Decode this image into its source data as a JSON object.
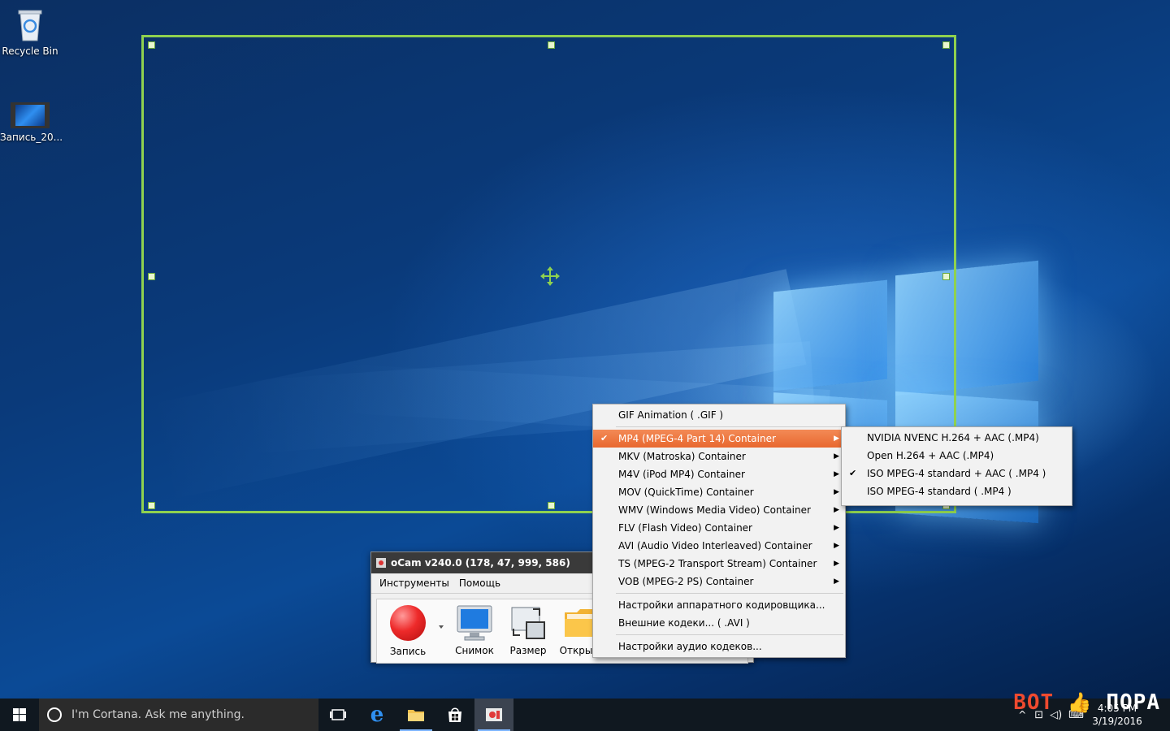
{
  "desktop": {
    "icons": [
      {
        "label": "Recycle Bin",
        "icon": "recycle-bin-icon"
      },
      {
        "label": "Запись_20...",
        "icon": "video-file-icon"
      }
    ]
  },
  "ocam": {
    "title": "oCam v240.0 (178, 47, 999, 586)",
    "menu": [
      "Инструменты",
      "Помощь"
    ],
    "tools": [
      {
        "label": "Запись",
        "icon": "record-icon"
      },
      {
        "label": "Снимок",
        "icon": "monitor-icon"
      },
      {
        "label": "Размер",
        "icon": "resize-icon"
      },
      {
        "label": "Открыть",
        "icon": "folder-icon"
      }
    ]
  },
  "format_menu": {
    "items": [
      {
        "label": "GIF Animation ( .GIF )",
        "checked": false,
        "submenu": false
      },
      {
        "label": "MP4 (MPEG-4 Part 14) Container",
        "checked": true,
        "submenu": true,
        "highlighted": true
      },
      {
        "label": "MKV (Matroska) Container",
        "checked": false,
        "submenu": true
      },
      {
        "label": "M4V (iPod MP4) Container",
        "checked": false,
        "submenu": true
      },
      {
        "label": "MOV (QuickTime) Container",
        "checked": false,
        "submenu": true
      },
      {
        "label": "WMV (Windows Media Video) Container",
        "checked": false,
        "submenu": true
      },
      {
        "label": "FLV (Flash Video) Container",
        "checked": false,
        "submenu": true
      },
      {
        "label": "AVI (Audio Video Interleaved) Container",
        "checked": false,
        "submenu": true
      },
      {
        "label": "TS (MPEG-2 Transport Stream) Container",
        "checked": false,
        "submenu": true
      },
      {
        "label": "VOB (MPEG-2 PS) Container",
        "checked": false,
        "submenu": true
      }
    ],
    "settings": [
      "Настройки аппаратного кодировщика...",
      "Внешние кодеки... ( .AVI )"
    ],
    "audio": "Настройки аудио кодеков..."
  },
  "mp4_submenu": {
    "items": [
      {
        "label": "NVIDIA NVENC H.264 + AAC (.MP4)",
        "checked": false
      },
      {
        "label": "Open H.264 + AAC (.MP4)",
        "checked": false
      },
      {
        "label": "ISO MPEG-4 standard + AAC ( .MP4 )",
        "checked": true
      },
      {
        "label": "ISO MPEG-4 standard ( .MP4 )",
        "checked": false
      }
    ]
  },
  "taskbar": {
    "search_placeholder": "I'm Cortana. Ask me anything.",
    "apps": [
      "task-view-icon",
      "edge-icon",
      "file-explorer-icon",
      "store-icon",
      "ocam-icon"
    ],
    "time": "4:05 PM",
    "date": "3/19/2016"
  },
  "watermark": {
    "part1": "BOT",
    "part2": "ПОРА"
  },
  "colors": {
    "accent": "#e8682f",
    "region": "#8fd14f",
    "taskbar": "#101820"
  }
}
